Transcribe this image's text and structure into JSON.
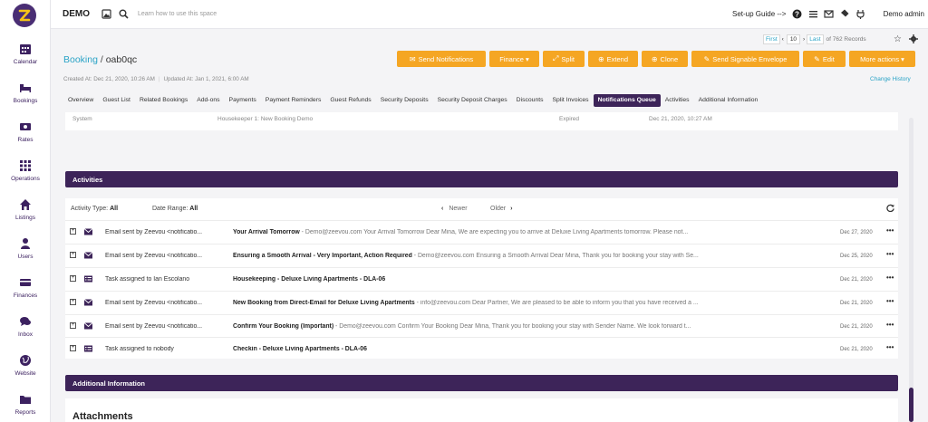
{
  "app": {
    "name": "DEMO",
    "hint": "Learn how to use this space",
    "setup_guide": "Set-up Guide -->",
    "user": "Demo admin"
  },
  "sidebar": {
    "items": [
      {
        "label": "Calendar",
        "icon": "calendar-icon"
      },
      {
        "label": "Bookings",
        "icon": "bed-icon"
      },
      {
        "label": "Rates",
        "icon": "money-icon"
      },
      {
        "label": "Operations",
        "icon": "grid-icon"
      },
      {
        "label": "Listings",
        "icon": "home-icon"
      },
      {
        "label": "Users",
        "icon": "user-icon"
      },
      {
        "label": "Finances",
        "icon": "card-icon"
      },
      {
        "label": "Inbox",
        "icon": "chat-icon"
      },
      {
        "label": "Website",
        "icon": "globe-icon"
      },
      {
        "label": "Reports",
        "icon": "folder-icon"
      }
    ]
  },
  "breadcrumb": {
    "parent": "Booking",
    "separator": " / ",
    "current": "oab0qc"
  },
  "meta": {
    "created": "Created At: Dec 21, 2020, 10:26 AM",
    "updated": "Updated At: Jan 1, 2021, 6:00 AM"
  },
  "change_history": "Change History",
  "pager": {
    "first": "First",
    "page": "10",
    "last": "Last",
    "of": "of 762 Records"
  },
  "actions": {
    "send_notifications": "Send Notifications",
    "finance": "Finance",
    "split": "Split",
    "extend": "Extend",
    "clone": "Clone",
    "send_envelope": "Send Signable Envelope",
    "edit": "Edit",
    "more": "More actions"
  },
  "tabs": [
    "Overview",
    "Guest List",
    "Related Bookings",
    "Add-ons",
    "Payments",
    "Payment Reminders",
    "Guest Refunds",
    "Security Deposits",
    "Security Deposit Charges",
    "Discounts",
    "Split Invoices",
    "Notifications Queue",
    "Activities",
    "Additional Information"
  ],
  "active_tab": "Notifications Queue",
  "queue_fragment": {
    "c1": "System",
    "c2": "Housekeeper 1: New Booking Demo",
    "c3": "Expired",
    "c4": "Dec 21, 2020, 10:27 AM"
  },
  "activities": {
    "title": "Activities",
    "activity_type_label": "Activity Type:",
    "activity_type_value": "All",
    "date_range_label": "Date Range:",
    "date_range_value": "All",
    "newer": "Newer",
    "older": "Older",
    "rows": [
      {
        "type": "email",
        "from": "Email sent by Zeevou <notificatio...",
        "subject": "Your Arrival Tomorrow",
        "snippet": " - Demo@zeevou.com Your Arrival Tomorrow Dear Mina, We are expecting you to arrive at Deluxe Living Apartments tomorrow. Please not...",
        "date": "Dec 27, 2020"
      },
      {
        "type": "email",
        "from": "Email sent by Zeevou <notificatio...",
        "subject": "Ensuring a Smooth Arrival - Very Important, Action Required",
        "snippet": " - Demo@zeevou.com Ensuring a Smooth Arrival Dear Mina, Thank you for booking your stay with Se...",
        "date": "Dec 25, 2020"
      },
      {
        "type": "task",
        "from": "Task assigned to Ian Escolano",
        "subject": "Housekeeping - Deluxe Living Apartments - DLA-06",
        "snippet": "",
        "date": "Dec 21, 2020"
      },
      {
        "type": "email",
        "from": "Email sent by Zeevou <notificatio...",
        "subject": "New Booking from Direct-Email for Deluxe Living Apartments",
        "snippet": " - info@zeevou.com Dear Partner, We are pleased to be able to inform you that you have received a ...",
        "date": "Dec 21, 2020"
      },
      {
        "type": "email",
        "from": "Email sent by Zeevou <notificatio...",
        "subject": "Confirm Your Booking (Important)",
        "snippet": " - Demo@zeevou.com Confirm Your Booking Dear Mina, Thank you for booking your stay with Sender Name. We look forward t...",
        "date": "Dec 21, 2020"
      },
      {
        "type": "task",
        "from": "Task assigned to nobody",
        "subject": "Checkin - Deluxe Living Apartments - DLA-06",
        "snippet": "",
        "date": "Dec 21, 2020"
      }
    ]
  },
  "additional_info": {
    "title": "Additional Information",
    "attachments": "Attachments"
  },
  "colors": {
    "brand": "#3d2459",
    "accent": "#f5a623",
    "link": "#2aa3c6"
  }
}
